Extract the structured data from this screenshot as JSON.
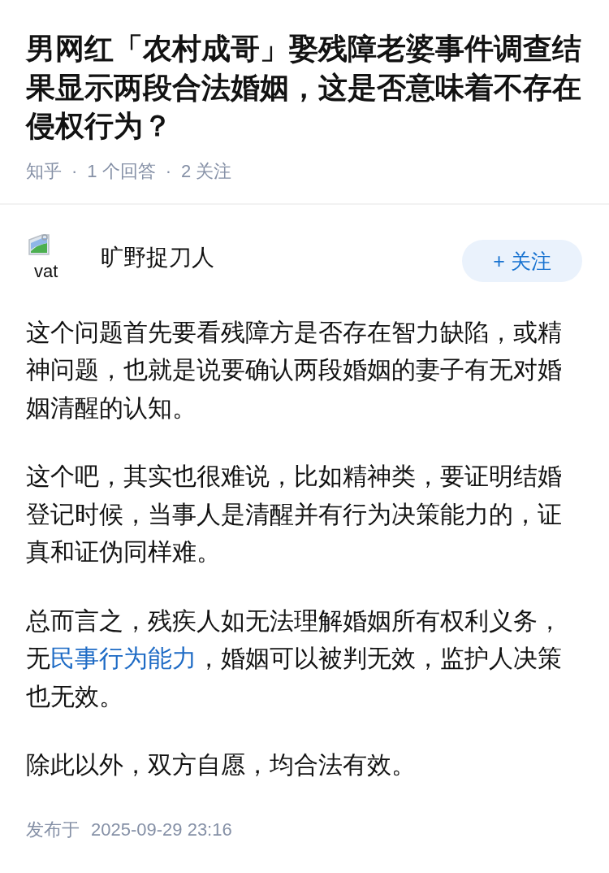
{
  "question": {
    "title": "男网红「农村成哥」娶残障老婆事件调查结果显示两段合法婚姻，这是否意味着不存在侵权行为？",
    "meta": [
      {
        "kind": "label",
        "text": "知乎"
      },
      {
        "kind": "separator",
        "text": "·"
      },
      {
        "kind": "label",
        "text": "1 个回答"
      },
      {
        "kind": "separator",
        "text": "·"
      },
      {
        "kind": "label",
        "text": "2 关注"
      }
    ]
  },
  "answer": {
    "author": {
      "avatar_alt_text": "vat",
      "name": "旷野捉刀人"
    },
    "follow_button": {
      "label": "+ 关注"
    },
    "paragraphs": [
      [
        {
          "kind": "text",
          "text": "这个问题首先要看残障方是否存在智力缺陷，或精神问题，也就是说要确认两段婚姻的妻子有无对婚姻清醒的认知。"
        }
      ],
      [
        {
          "kind": "text",
          "text": "这个吧，其实也很难说，比如精神类，要证明结婚登记时候，当事人是清醒并有行为决策能力的，证真和证伪同样难。"
        }
      ],
      [
        {
          "kind": "text",
          "text": "总而言之，残疾人如无法理解婚姻所有权利义务，无"
        },
        {
          "kind": "link",
          "text": "民事行为能力"
        },
        {
          "kind": "text",
          "text": "，婚姻可以被判无效，监护人决策也无效。"
        }
      ],
      [
        {
          "kind": "text",
          "text": "除此以外，双方自愿，均合法有效。"
        }
      ]
    ],
    "published": {
      "label": "发布于",
      "time": "2025-09-29 23:16"
    }
  }
}
